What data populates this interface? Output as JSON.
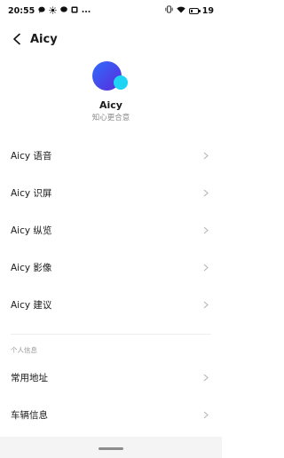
{
  "status_bar": {
    "time": "20:55",
    "battery": "19",
    "battery_level": 0.19,
    "left_icons": [
      "chat-bubble-icon",
      "sun-icon",
      "message-icon",
      "notification-icon",
      "more-dots-icon"
    ],
    "right_icons": [
      "vibrate-icon",
      "wifi-icon",
      "battery-icon"
    ]
  },
  "header": {
    "title": "Aicy"
  },
  "profile": {
    "name": "Aicy",
    "tagline": "知心更合意",
    "logo_colors": {
      "primary_start": "#2f6bff",
      "primary_end": "#5a2bd8",
      "accent": "#1fd3f5"
    }
  },
  "menu_items": [
    {
      "label": "Aicy 语音"
    },
    {
      "label": "Aicy 识屏"
    },
    {
      "label": "Aicy 纵览"
    },
    {
      "label": "Aicy 影像"
    },
    {
      "label": "Aicy 建议"
    }
  ],
  "personal_section": {
    "heading": "个人信息",
    "items": [
      {
        "label": "常用地址"
      },
      {
        "label": "车辆信息"
      }
    ]
  }
}
